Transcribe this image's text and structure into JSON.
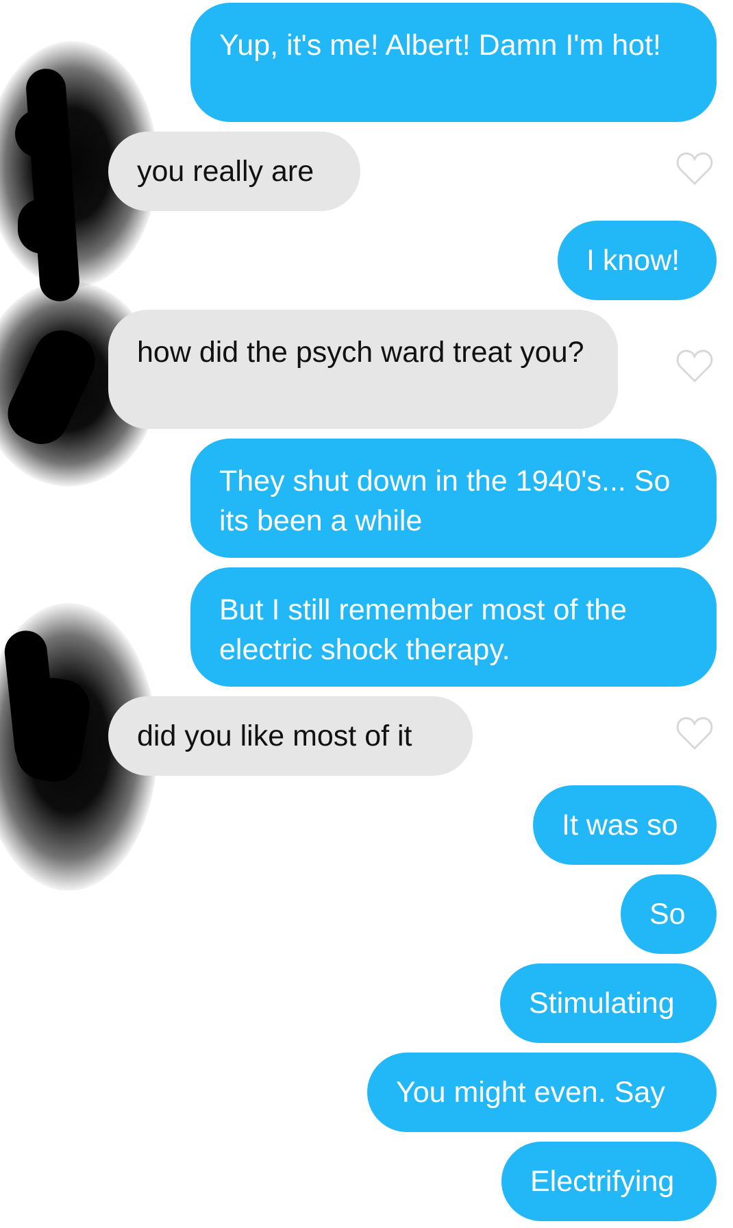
{
  "messages": [
    {
      "from": "me",
      "text": "Yup, it's me! Albert! Damn I'm hot!"
    },
    {
      "from": "them",
      "text": "you really are"
    },
    {
      "from": "me",
      "text": "I know!"
    },
    {
      "from": "them",
      "text": "how did the psych ward treat you?"
    },
    {
      "from": "me",
      "text": "They shut down in the 1940's... So its been a while"
    },
    {
      "from": "me",
      "text": "But I still remember most of the electric shock therapy."
    },
    {
      "from": "them",
      "text": "did you like most of it"
    },
    {
      "from": "me",
      "text": "It was so"
    },
    {
      "from": "me",
      "text": "So"
    },
    {
      "from": "me",
      "text": "Stimulating"
    },
    {
      "from": "me",
      "text": "You might even. Say"
    },
    {
      "from": "me",
      "text": "Electrifying"
    }
  ],
  "colors": {
    "sent_bubble": "#22b8f7",
    "received_bubble": "#e6e6e6",
    "sent_text": "#ffffff",
    "received_text": "#111111"
  },
  "icons": {
    "like": "heart-outline-icon",
    "avatar": "redacted-avatar"
  }
}
